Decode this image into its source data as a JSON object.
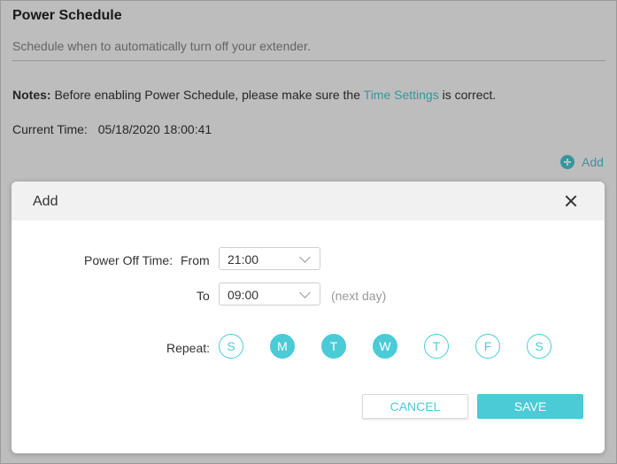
{
  "page": {
    "title": "Power Schedule",
    "description": "Schedule when to automatically turn off your extender.",
    "notes_label": "Notes:",
    "notes_text": "Before enabling Power Schedule, please make sure the",
    "notes_link": "Time Settings",
    "notes_suffix": "is correct.",
    "current_time_label": "Current Time:",
    "current_time_value": "05/18/2020 18:00:41",
    "add_label": "Add"
  },
  "modal": {
    "title": "Add",
    "power_off_label": "Power Off Time:",
    "from_label": "From",
    "from_value": "21:00",
    "to_label": "To",
    "to_value": "09:00",
    "next_day_note": "(next day)",
    "repeat_label": "Repeat:",
    "days": [
      {
        "label": "S",
        "selected": false
      },
      {
        "label": "M",
        "selected": true
      },
      {
        "label": "T",
        "selected": true
      },
      {
        "label": "W",
        "selected": true
      },
      {
        "label": "T",
        "selected": false
      },
      {
        "label": "F",
        "selected": false
      },
      {
        "label": "S",
        "selected": false
      }
    ],
    "cancel_label": "CANCEL",
    "save_label": "SAVE"
  },
  "colors": {
    "accent": "#4acbd6",
    "overlay": "rgba(0,0,0,0.26)"
  }
}
